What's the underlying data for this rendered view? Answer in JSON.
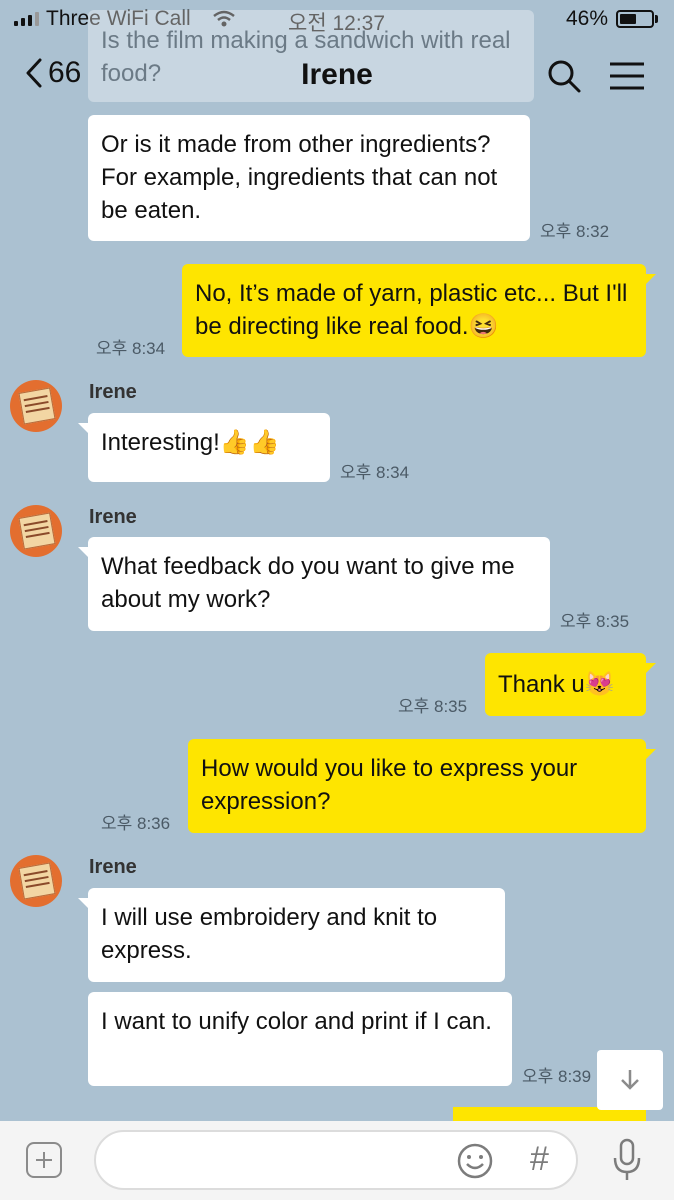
{
  "status_bar": {
    "carrier": "Three WiFi Call",
    "time": "오전 12:37",
    "battery": "46%"
  },
  "header": {
    "back_count": "66",
    "title": "Irene"
  },
  "messages": {
    "faded_text": "Is the film making a sandwich with real food?",
    "m1": {
      "text": "Or is it made from other ingredients? For example, ingredients that can not be eaten.",
      "time": "오후 8:32"
    },
    "m2": {
      "text": "No, It’s made of yarn, plastic etc... But I'll be directing like real food.",
      "emoji": "😆",
      "time": "오후 8:34"
    },
    "m3": {
      "sender": "Irene",
      "text": "Interesting!",
      "emoji": "👍👍",
      "time": "오후 8:34"
    },
    "m4": {
      "sender": "Irene",
      "text": "What feedback do you want to give me about my work?",
      "time": "오후 8:35"
    },
    "m5": {
      "text": "Thank u",
      "emoji": "😻",
      "time": "오후 8:35"
    },
    "m6": {
      "text": "How would you like to express your expression?",
      "time": "오후 8:36"
    },
    "m7": {
      "sender": "Irene",
      "text": "I will use embroidery and knit to express."
    },
    "m8": {
      "text": "I want to unify color and print if I can.",
      "time": "오후 8:39"
    }
  },
  "composer": {
    "placeholder": "",
    "hash_label": "#"
  },
  "icons": [
    "back-chevron-icon",
    "search-icon",
    "menu-icon",
    "plus-icon",
    "emoji-icon",
    "hashtag-icon",
    "microphone-icon",
    "scroll-down-icon"
  ]
}
